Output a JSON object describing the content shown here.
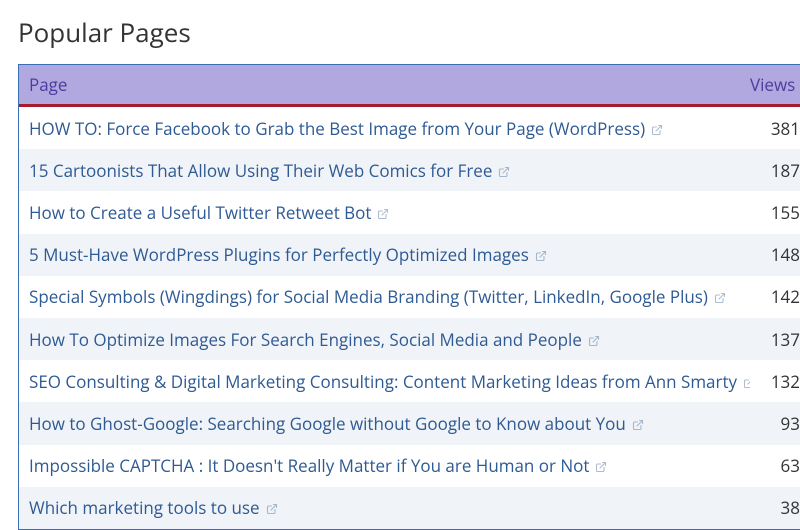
{
  "title": "Popular Pages",
  "columns": {
    "page": "Page",
    "views": "Views"
  },
  "rows": [
    {
      "title": "HOW TO: Force Facebook to Grab the Best Image from Your Page (WordPress)",
      "views": "381"
    },
    {
      "title": "15 Cartoonists That Allow Using Their Web Comics for Free",
      "views": "187"
    },
    {
      "title": "How to Create a Useful Twitter Retweet Bot",
      "views": "155"
    },
    {
      "title": "5 Must-Have WordPress Plugins for Perfectly Optimized Images",
      "views": "148"
    },
    {
      "title": "Special Symbols (Wingdings) for Social Media Branding (Twitter, LinkedIn, Google Plus)",
      "views": "142"
    },
    {
      "title": "How To Optimize Images For Search Engines, Social Media and People",
      "views": "137"
    },
    {
      "title": "SEO Consulting & Digital Marketing Consulting: Content Marketing Ideas from Ann Smarty",
      "views": "132"
    },
    {
      "title": "How to Ghost-Google: Searching Google without Google to Know about You",
      "views": "93"
    },
    {
      "title": "Impossible CAPTCHA : It Doesn't Really Matter if You are Human or Not",
      "views": "63"
    },
    {
      "title": "Which marketing tools to use",
      "views": "38"
    }
  ],
  "icons": {
    "external": "external-link-icon"
  }
}
